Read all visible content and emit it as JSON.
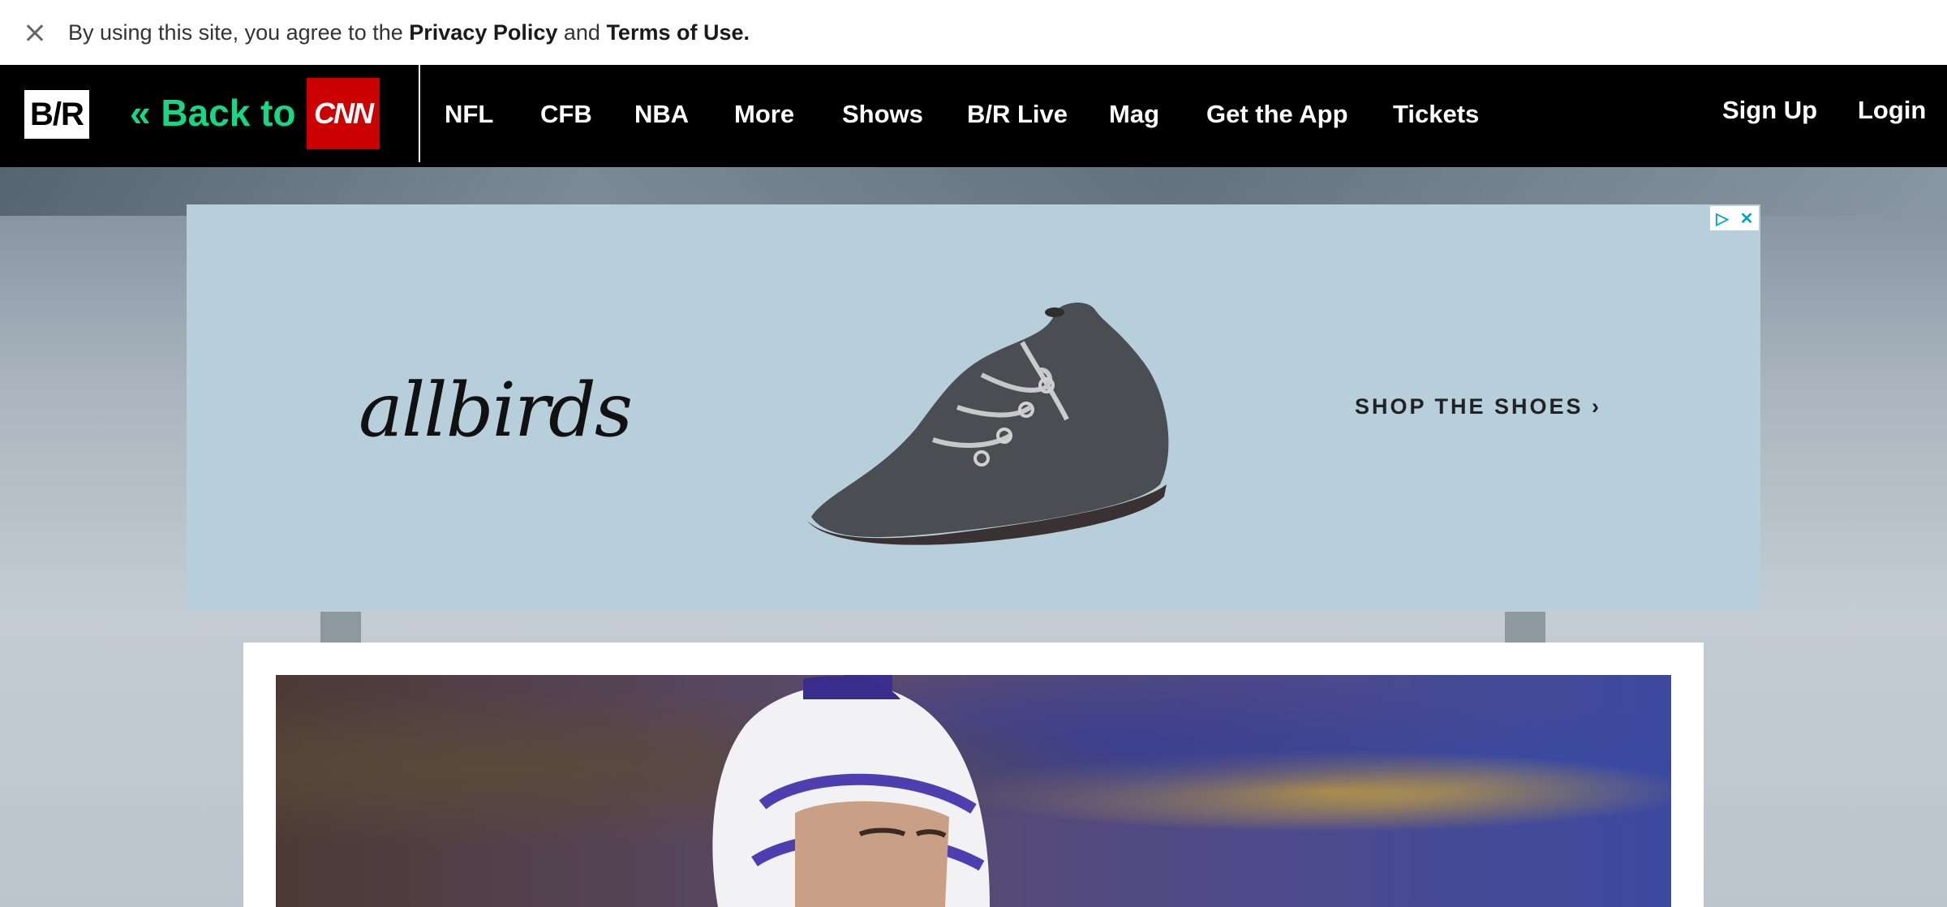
{
  "consent": {
    "prefix": "By using this site, you agree to the ",
    "privacy_link": "Privacy Policy",
    "middle": " and ",
    "terms_link": "Terms of Use."
  },
  "nav": {
    "logo": "B/R",
    "back_label": "« Back to",
    "partner_logo": "CNN",
    "items": [
      "NFL",
      "CFB",
      "NBA",
      "More",
      "Shows",
      "B/R Live",
      "Mag",
      "Get the App",
      "Tickets"
    ],
    "sign_up": "Sign Up",
    "login": "Login"
  },
  "ad": {
    "brand": "allbirds",
    "cta": "SHOP THE SHOES ›",
    "adchoices_icon": "adchoices-icon",
    "close_icon": "close-icon"
  },
  "colors": {
    "accent": "#16d784",
    "cnn_red": "#cc0000",
    "ad_bg": "#b6cfda"
  }
}
